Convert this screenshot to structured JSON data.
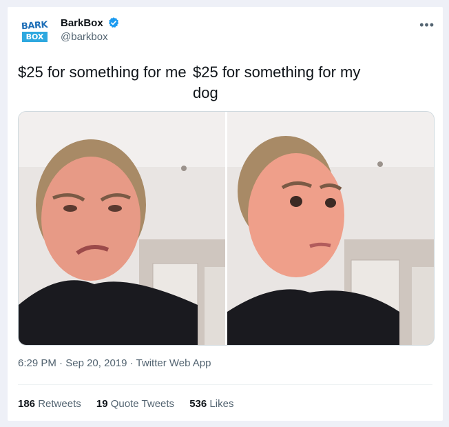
{
  "tweet": {
    "display_name": "BarkBox",
    "handle": "@barkbox",
    "more_icon": "more-horizontal-icon",
    "verified_icon": "verified-badge-icon",
    "logo": {
      "top": "BARK",
      "bottom": "BOX"
    },
    "caption_left": "$25 for something for me",
    "caption_right": "$25 for something for my dog",
    "images": [
      {
        "name": "disgusted-face-photo"
      },
      {
        "name": "interested-face-photo"
      }
    ],
    "meta": {
      "time": "6:29 PM",
      "date": "Sep 20, 2019",
      "source": "Twitter Web App",
      "separator": " · "
    },
    "stats": {
      "retweets_count": "186",
      "retweets_label": "Retweets",
      "quotes_count": "19",
      "quotes_label": "Quote Tweets",
      "likes_count": "536",
      "likes_label": "Likes"
    },
    "colors": {
      "verified": "#1d9bf0",
      "logo_blue": "#2ea8df",
      "text": "#0f1419",
      "muted": "#536471"
    }
  }
}
